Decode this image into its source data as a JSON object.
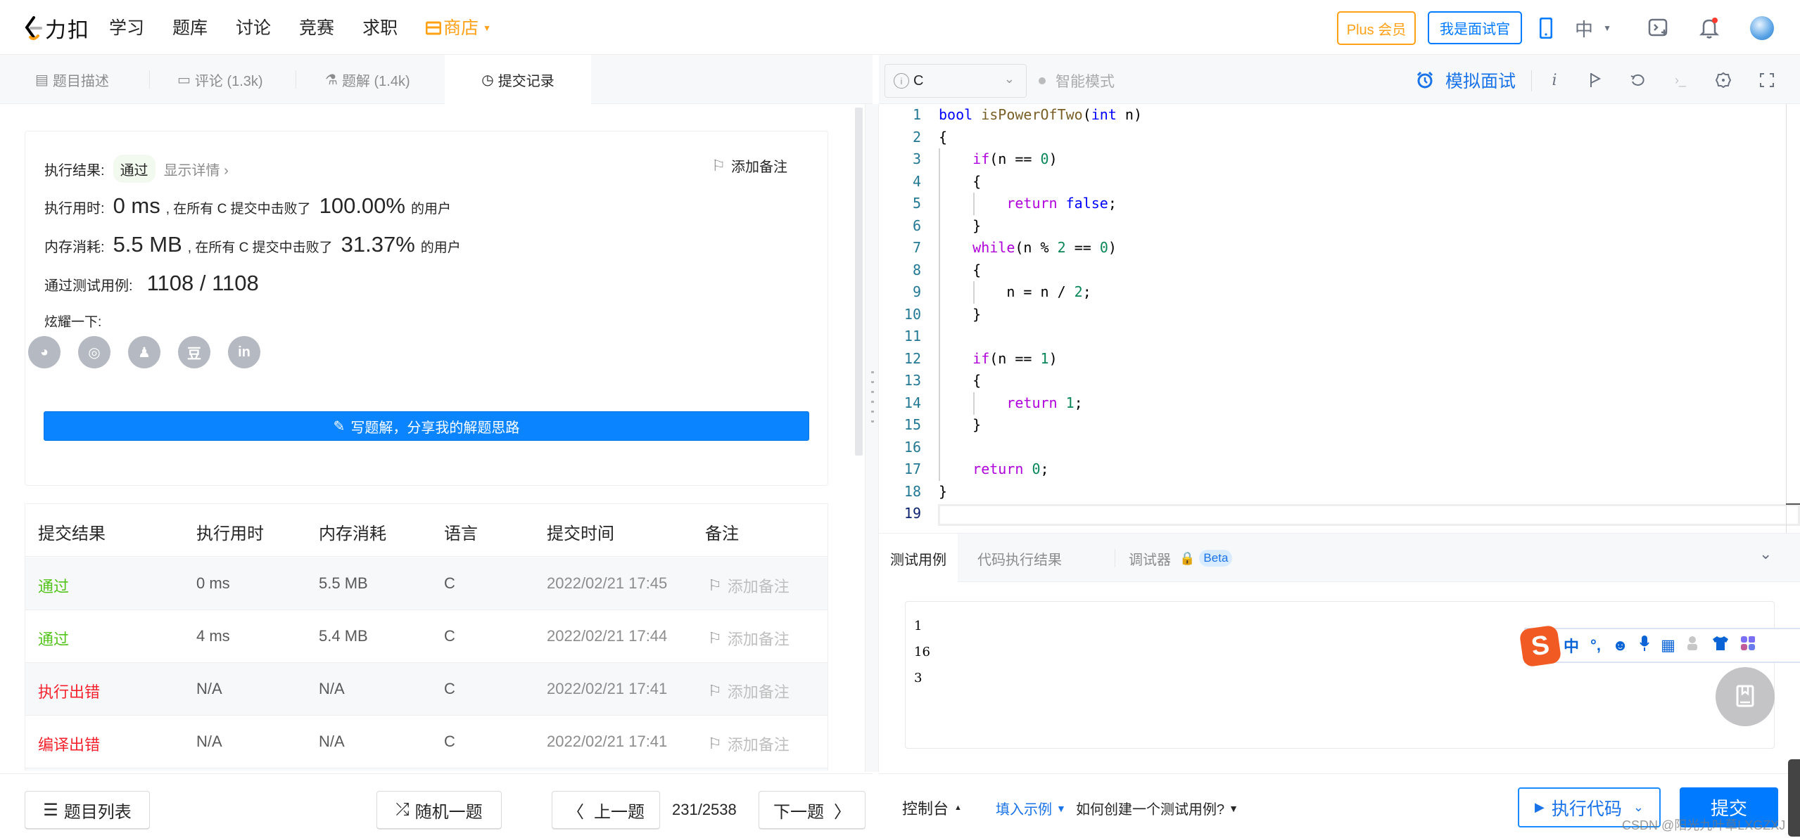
{
  "header": {
    "logo_text": "力扣",
    "nav": [
      "学习",
      "题库",
      "讨论",
      "竞赛",
      "求职"
    ],
    "store_label": "商店",
    "plus_label": "Plus 会员",
    "interviewer_label": "我是面试官",
    "lang_label": "中",
    "icons": [
      "phone-icon",
      "language-caret-icon",
      "playground-icon",
      "notification-bell-icon",
      "avatar"
    ]
  },
  "left_tabs": [
    {
      "label": "题目描述",
      "icon": "description-icon"
    },
    {
      "label": "评论 (1.3k)",
      "icon": "comment-icon"
    },
    {
      "label": "题解 (1.4k)",
      "icon": "flask-icon"
    },
    {
      "label": "提交记录",
      "icon": "clock-icon",
      "active": true
    }
  ],
  "result": {
    "result_label": "执行结果:",
    "result_value": "通过",
    "show_detail": "显示详情",
    "add_note": "添加备注",
    "runtime_label": "执行用时:",
    "runtime_value": "0 ms",
    "beat_prefix": ", 在所有 C 提交中击败了",
    "runtime_percent": "100.00%",
    "users_suffix": "的用户",
    "memory_label": "内存消耗:",
    "memory_value": "5.5 MB",
    "memory_percent": "31.37%",
    "cases_label": "通过测试用例:",
    "cases_value": "1108 / 1108",
    "share_label": "炫耀一下:",
    "share_icons": [
      "wechat-icon",
      "weibo-icon",
      "qq-icon",
      "douban-icon",
      "linkedin-icon"
    ],
    "write_solution": "写题解，分享我的解题思路"
  },
  "table": {
    "headers": [
      "提交结果",
      "执行用时",
      "内存消耗",
      "语言",
      "提交时间",
      "备注"
    ],
    "rows": [
      {
        "status": "通过",
        "status_type": "ok",
        "runtime": "0 ms",
        "memory": "5.5 MB",
        "lang": "C",
        "time": "2022/02/21 17:45",
        "note": "添加备注"
      },
      {
        "status": "通过",
        "status_type": "ok",
        "runtime": "4 ms",
        "memory": "5.4 MB",
        "lang": "C",
        "time": "2022/02/21 17:44",
        "note": "添加备注"
      },
      {
        "status": "执行出错",
        "status_type": "err",
        "runtime": "N/A",
        "memory": "N/A",
        "lang": "C",
        "time": "2022/02/21 17:41",
        "note": "添加备注"
      },
      {
        "status": "编译出错",
        "status_type": "err",
        "runtime": "N/A",
        "memory": "N/A",
        "lang": "C",
        "time": "2022/02/21 17:41",
        "note": "添加备注"
      }
    ]
  },
  "bottom_left": {
    "problem_list": "题目列表",
    "random": "随机一题",
    "prev": "上一题",
    "page": "231/2538",
    "next": "下一题"
  },
  "editor_toolbar": {
    "language": "C",
    "smart_mode": "智能模式",
    "mock_interview": "模拟面试",
    "icons": [
      "info-icon",
      "flag-icon",
      "reset-icon",
      "terminal-icon",
      "settings-icon",
      "fullscreen-icon"
    ]
  },
  "code": {
    "lines": [
      "bool isPowerOfTwo(int n)",
      "{",
      "    if(n == 0)",
      "    {",
      "        return false;",
      "    }",
      "    while(n % 2 == 0)",
      "    {",
      "        n = n / 2;",
      "    }",
      "",
      "    if(n == 1)",
      "    {",
      "        return 1;",
      "    }",
      "",
      "    return 0;",
      "}",
      ""
    ],
    "current_line": 19
  },
  "testcase": {
    "tabs": [
      "测试用例",
      "代码执行结果",
      "调试器"
    ],
    "beta_label": "Beta",
    "inputs": [
      "1",
      "16",
      "3"
    ]
  },
  "ime_toolbar": {
    "logo": "S",
    "items": [
      "中",
      "°,",
      "☻",
      "🎤",
      "▦",
      "👤",
      "👕",
      "▚"
    ]
  },
  "bottom_right": {
    "console": "控制台",
    "fill_example": "填入示例",
    "how_create": "如何创建一个测试用例?",
    "run_code": "执行代码",
    "submit": "提交",
    "watermark": "CSDN @阳光九叶草LXGZXJ"
  },
  "colors": {
    "brand_orange": "#ffa116",
    "primary_blue": "#007aff",
    "success_green": "#52c41a",
    "error_red": "#f5222d"
  }
}
